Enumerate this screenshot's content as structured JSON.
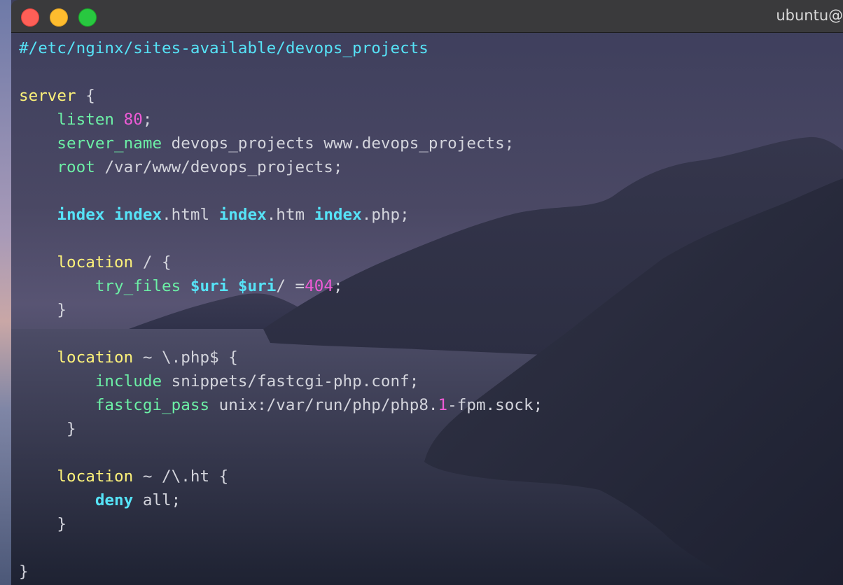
{
  "window": {
    "title": "ubuntu@i"
  },
  "colors": {
    "comment": "#56e3f7",
    "block_keyword": "#fdf27a",
    "directive": "#6cf0a6",
    "number": "#ee5bd6",
    "bold_keyword": "#56e3f7",
    "plain": "#d3d4dc"
  },
  "terminal": {
    "lines": [
      [
        {
          "t": "#/etc/nginx/sites-available/devops_projects",
          "c": "cyan"
        }
      ],
      [],
      [
        {
          "t": "server",
          "c": "yellow"
        },
        {
          "t": " {"
        }
      ],
      [
        {
          "t": "    "
        },
        {
          "t": "listen",
          "c": "green"
        },
        {
          "t": " "
        },
        {
          "t": "80",
          "c": "magenta"
        },
        {
          "t": ";"
        }
      ],
      [
        {
          "t": "    "
        },
        {
          "t": "server_name",
          "c": "green"
        },
        {
          "t": " devops_projects www.devops_projects;"
        }
      ],
      [
        {
          "t": "    "
        },
        {
          "t": "root",
          "c": "green"
        },
        {
          "t": " /var/www/devops_projects;"
        }
      ],
      [],
      [
        {
          "t": "    "
        },
        {
          "t": "index",
          "c": "cyan bold"
        },
        {
          "t": " "
        },
        {
          "t": "index",
          "c": "cyan bold"
        },
        {
          "t": ".html "
        },
        {
          "t": "index",
          "c": "cyan bold"
        },
        {
          "t": ".htm "
        },
        {
          "t": "index",
          "c": "cyan bold"
        },
        {
          "t": ".php;"
        }
      ],
      [],
      [
        {
          "t": "    "
        },
        {
          "t": "location",
          "c": "yellow"
        },
        {
          "t": " / {"
        }
      ],
      [
        {
          "t": "        "
        },
        {
          "t": "try_files",
          "c": "green"
        },
        {
          "t": " "
        },
        {
          "t": "$uri",
          "c": "cyan bold"
        },
        {
          "t": " "
        },
        {
          "t": "$uri",
          "c": "cyan bold"
        },
        {
          "t": "/ ="
        },
        {
          "t": "404",
          "c": "magenta"
        },
        {
          "t": ";"
        }
      ],
      [
        {
          "t": "    }"
        }
      ],
      [],
      [
        {
          "t": "    "
        },
        {
          "t": "location",
          "c": "yellow"
        },
        {
          "t": " ~ \\.php$ {"
        }
      ],
      [
        {
          "t": "        "
        },
        {
          "t": "include",
          "c": "green"
        },
        {
          "t": " snippets/fastcgi-php.conf;"
        }
      ],
      [
        {
          "t": "        "
        },
        {
          "t": "fastcgi_pass",
          "c": "green"
        },
        {
          "t": " unix:/var/run/php/php8."
        },
        {
          "t": "1",
          "c": "magenta"
        },
        {
          "t": "-fpm.sock;"
        }
      ],
      [
        {
          "t": "     }"
        }
      ],
      [],
      [
        {
          "t": "    "
        },
        {
          "t": "location",
          "c": "yellow"
        },
        {
          "t": " ~ /\\.ht {"
        }
      ],
      [
        {
          "t": "        "
        },
        {
          "t": "deny",
          "c": "cyan bold"
        },
        {
          "t": " all;"
        }
      ],
      [
        {
          "t": "    }"
        }
      ],
      [],
      [
        {
          "t": "}"
        }
      ]
    ]
  }
}
